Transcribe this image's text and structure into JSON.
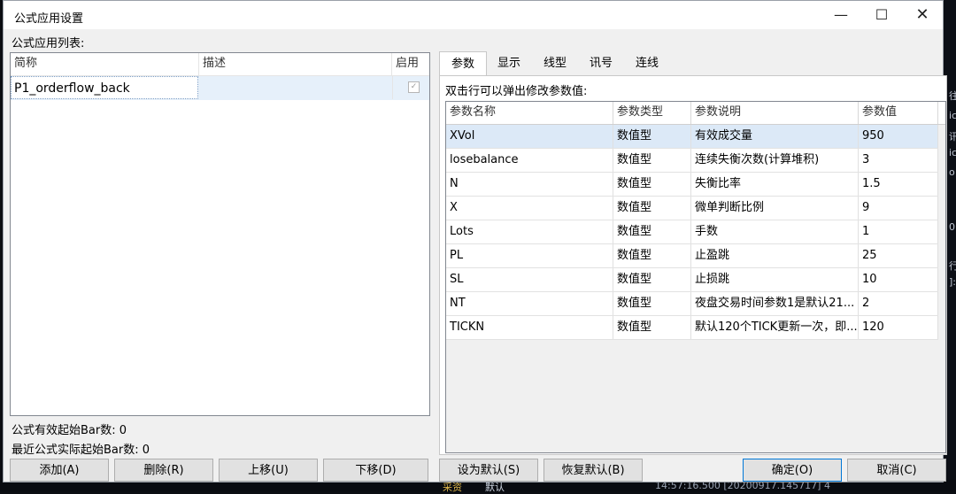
{
  "window": {
    "title": "公式应用设置",
    "minimize": "—",
    "maximize": "☐",
    "close": "✕"
  },
  "left": {
    "list_label": "公式应用列表:",
    "headers": [
      "简称",
      "描述",
      "启用"
    ],
    "row": {
      "name": "P1_orderflow_back",
      "desc": "",
      "enabled": "✓"
    },
    "stat_valid_label": "公式有效起始Bar数: 0",
    "stat_actual_label": "最近公式实际起始Bar数: 0"
  },
  "tabs": [
    "参数",
    "显示",
    "线型",
    "讯号",
    "连线"
  ],
  "params": {
    "hint": "双击行可以弹出修改参数值:",
    "headers": [
      "参数名称",
      "参数类型",
      "参数说明",
      "参数值"
    ],
    "rows": [
      {
        "name": "XVol",
        "type": "数值型",
        "desc": "有效成交量",
        "value": "950"
      },
      {
        "name": "losebalance",
        "type": "数值型",
        "desc": "连续失衡次数(计算堆积)",
        "value": "3"
      },
      {
        "name": "N",
        "type": "数值型",
        "desc": "失衡比率",
        "value": "1.5"
      },
      {
        "name": "X",
        "type": "数值型",
        "desc": "微单判断比例",
        "value": "9"
      },
      {
        "name": "Lots",
        "type": "数值型",
        "desc": "手数",
        "value": "1"
      },
      {
        "name": "PL",
        "type": "数值型",
        "desc": "止盈跳",
        "value": "25"
      },
      {
        "name": "SL",
        "type": "数值型",
        "desc": "止损跳",
        "value": "10"
      },
      {
        "name": "NT",
        "type": "数值型",
        "desc": "夜盘交易时间参数1是默认21...",
        "value": "2"
      },
      {
        "name": "TICKN",
        "type": "数值型",
        "desc": "默认120个TICK更新一次，即...",
        "value": "120"
      }
    ]
  },
  "buttons": {
    "add": "添加(A)",
    "delete": "删除(R)",
    "up": "上移(U)",
    "down": "下移(D)",
    "set_default": "设为默认(S)",
    "restore_default": "恢复默认(B)",
    "ok": "确定(O)",
    "cancel": "取消(C)"
  },
  "background": {
    "bottom_a": "采资",
    "bottom_b": "默认",
    "bottom_c": "14:57:16.500  [20200917.145717]   4",
    "right_chars": [
      "往",
      "ic",
      "讯",
      "ic",
      "o",
      "0",
      "行",
      "]:"
    ]
  }
}
